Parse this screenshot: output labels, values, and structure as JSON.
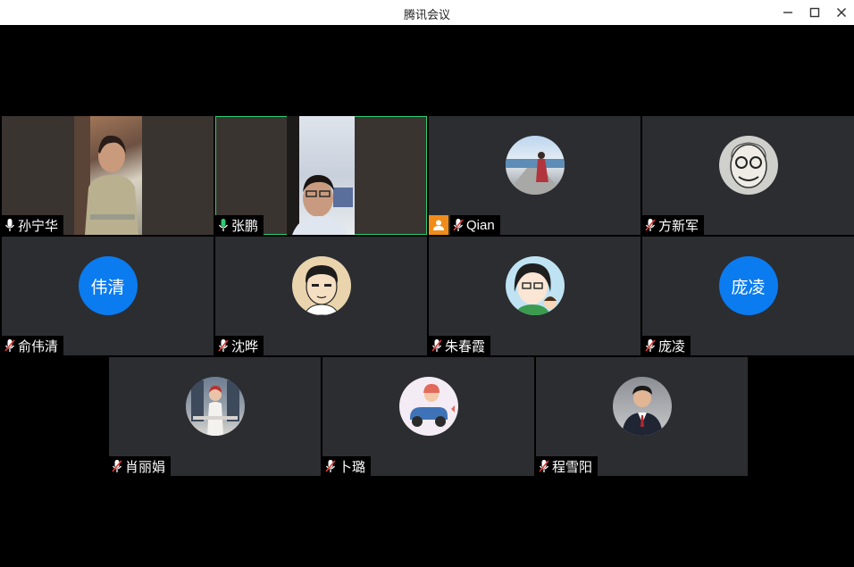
{
  "window": {
    "title": "腾讯会议",
    "minimize_icon": "minimize-icon",
    "maximize_icon": "maximize-icon",
    "close_icon": "close-icon"
  },
  "participants": [
    {
      "name": "孙宁华",
      "mic": "on",
      "mode": "video"
    },
    {
      "name": "张鹏",
      "mic": "on-speaking",
      "mode": "video",
      "active": true
    },
    {
      "name": "Qian",
      "mic": "muted",
      "mode": "avatar",
      "host_badge": "person-icon"
    },
    {
      "name": "方新军",
      "mic": "muted",
      "mode": "avatar"
    },
    {
      "name": "俞伟清",
      "mic": "muted",
      "mode": "text-avatar",
      "avatar_text": "伟清"
    },
    {
      "name": "沈晔",
      "mic": "muted",
      "mode": "avatar"
    },
    {
      "name": "朱春霞",
      "mic": "muted",
      "mode": "avatar"
    },
    {
      "name": "庞凌",
      "mic": "muted",
      "mode": "text-avatar",
      "avatar_text": "庞凌"
    },
    {
      "name": "肖丽娟",
      "mic": "muted",
      "mode": "avatar"
    },
    {
      "name": "卜璐",
      "mic": "muted",
      "mode": "avatar"
    },
    {
      "name": "程雪阳",
      "mic": "muted",
      "mode": "avatar"
    }
  ],
  "colors": {
    "tile_bg": "#2b2d31",
    "text_avatar_bg": "#0b7bf0",
    "speaking_border": "#2ecc71",
    "host_badge_bg": "#f08c1a",
    "mic_on": "#ffffff",
    "mic_speaking": "#2ecc71",
    "mic_muted_slash": "#e53935"
  }
}
